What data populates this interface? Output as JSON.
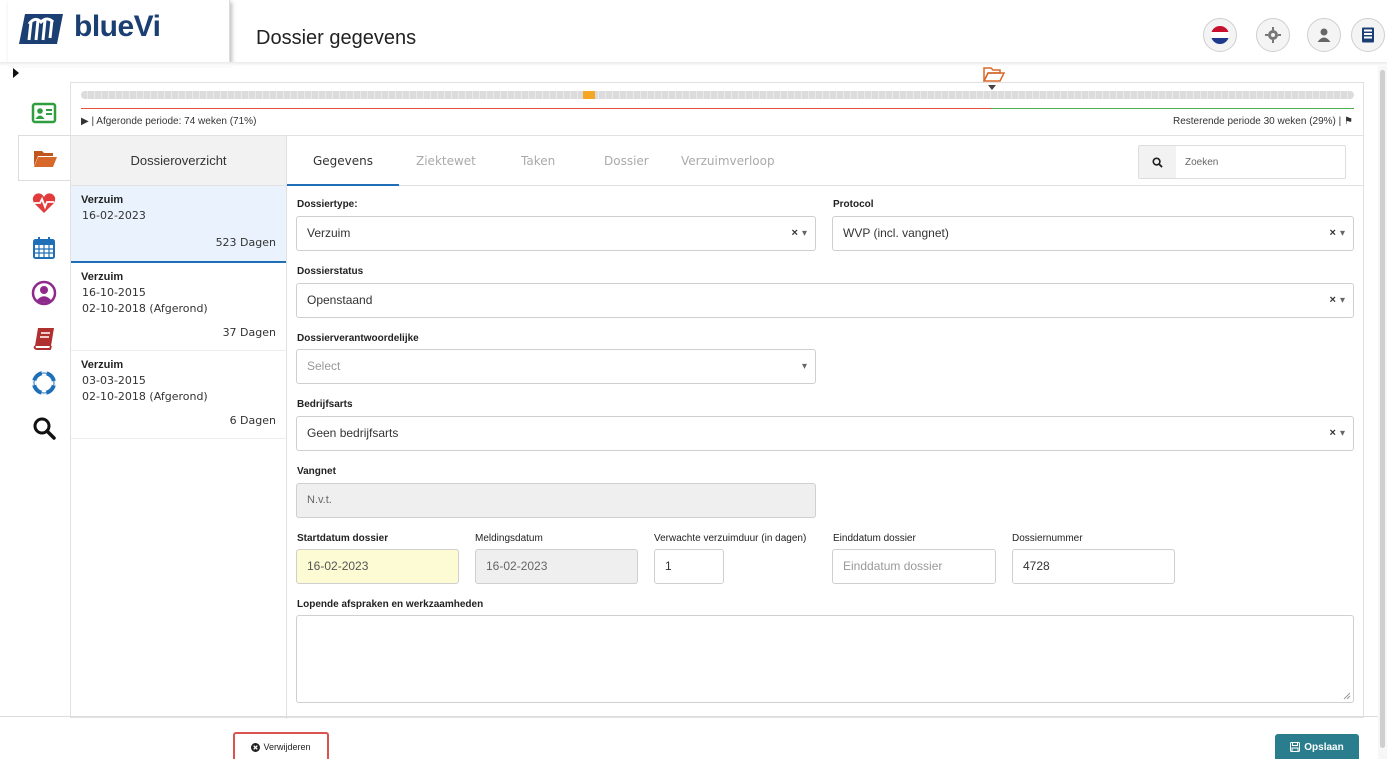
{
  "header": {
    "logo_text": "blueVi",
    "title": "Dossier gegevens",
    "buttons": [
      "flag-nl-icon",
      "gear-icon",
      "user-icon",
      "building-icon"
    ]
  },
  "sidebar": {
    "items": [
      {
        "icon": "id-card-icon",
        "color": "#2e9e3e"
      },
      {
        "icon": "folder-open-icon",
        "color": "#c0561b",
        "active": true
      },
      {
        "icon": "heartbeat-icon",
        "color": "#e23b3b"
      },
      {
        "icon": "calendar-icon",
        "color": "#1e6fb8"
      },
      {
        "icon": "user-circle-icon",
        "color": "#8e2a8c"
      },
      {
        "icon": "book-icon",
        "color": "#b03030"
      },
      {
        "icon": "life-ring-icon",
        "color": "#1e6fb8"
      },
      {
        "icon": "search-icon",
        "color": "#111111"
      }
    ]
  },
  "timeline": {
    "left_text": "▶ | Afgeronde periode: 74 weken (71%)",
    "right_text": "Resterende periode 30 weken (29%) | ⚑",
    "progress": 0.71
  },
  "dossier_list": {
    "heading": "Dossieroverzicht",
    "items": [
      {
        "type": "Verzuim",
        "start": "16-02-2023",
        "end": "",
        "days": "523 Dagen",
        "selected": true
      },
      {
        "type": "Verzuim",
        "start": "16-10-2015",
        "end": "02-10-2018 (Afgerond)",
        "days": "37 Dagen"
      },
      {
        "type": "Verzuim",
        "start": "03-03-2015",
        "end": "02-10-2018 (Afgerond)",
        "days": "6 Dagen"
      }
    ]
  },
  "tabs": [
    {
      "label": "Gegevens",
      "active": true
    },
    {
      "label": "Ziektewet"
    },
    {
      "label": "Taken"
    },
    {
      "label": "Dossier"
    },
    {
      "label": "Verzuimverloop"
    }
  ],
  "search": {
    "placeholder": "Zoeken"
  },
  "form": {
    "dossiertype": {
      "label": "Dossiertype:",
      "value": "Verzuim"
    },
    "protocol": {
      "label": "Protocol",
      "value": "WVP (incl. vangnet)"
    },
    "dossierstatus": {
      "label": "Dossierstatus",
      "value": "Openstaand"
    },
    "verantwoordelijke": {
      "label": "Dossierverantwoordelijke",
      "placeholder": "Select"
    },
    "bedrijfsarts": {
      "label": "Bedrijfsarts",
      "value": "Geen bedrijfsarts"
    },
    "vangnet": {
      "label": "Vangnet",
      "value": "N.v.t."
    },
    "startdatum": {
      "label": "Startdatum dossier",
      "value": "16-02-2023"
    },
    "meldingsdatum": {
      "label": "Meldingsdatum",
      "value": "16-02-2023"
    },
    "verzuimduur": {
      "label": "Verwachte verzuimduur (in dagen)",
      "value": "1"
    },
    "einddatum": {
      "label": "Einddatum dossier",
      "placeholder": "Einddatum dossier"
    },
    "dossiernummer": {
      "label": "Dossiernummer",
      "value": "4728"
    },
    "afspraken": {
      "label": "Lopende afspraken en werkzaamheden",
      "value": ""
    }
  },
  "footer": {
    "delete_label": "Verwijderen",
    "save_label": "Opslaan"
  }
}
